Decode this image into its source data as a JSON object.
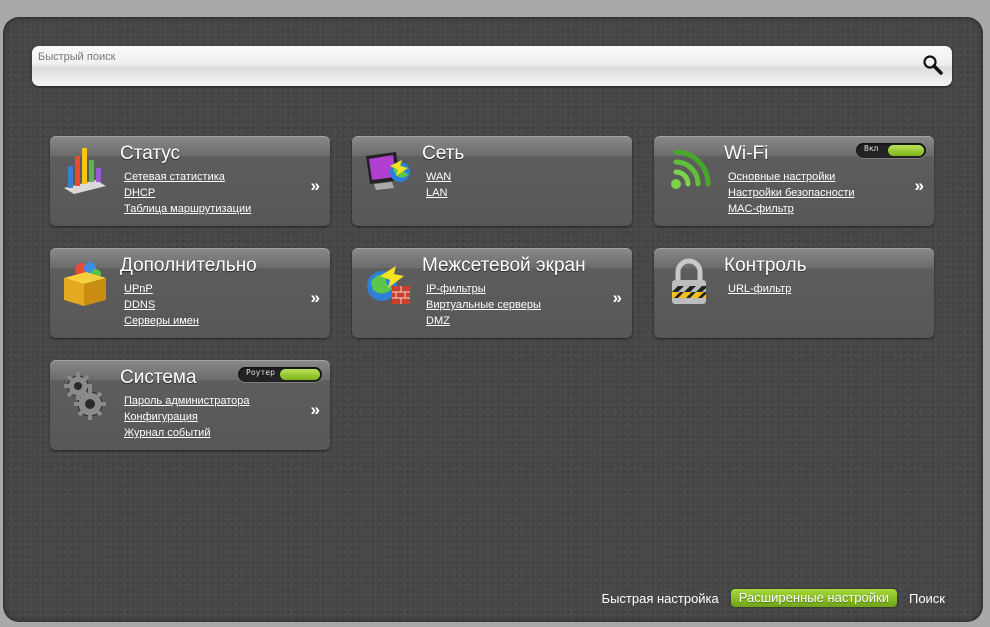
{
  "search": {
    "placeholder": "Быстрый поиск"
  },
  "cards": {
    "status": {
      "title": "Статус",
      "links": [
        "Сетевая статистика",
        "DHCP",
        "Таблица маршрутизации"
      ],
      "arrow": "»"
    },
    "network": {
      "title": "Сеть",
      "links": [
        "WAN",
        "LAN"
      ]
    },
    "wifi": {
      "title": "Wi-Fi",
      "links": [
        "Основные настройки",
        "Настройки безопасности",
        "MAC-фильтр"
      ],
      "arrow": "»",
      "toggle_label": "Вкл"
    },
    "advanced": {
      "title": "Дополнительно",
      "links": [
        "UPnP",
        "DDNS",
        "Серверы имен"
      ],
      "arrow": "»"
    },
    "firewall": {
      "title": "Межсетевой экран",
      "links": [
        "IP-фильтры",
        "Виртуальные серверы",
        "DMZ"
      ],
      "arrow": "»"
    },
    "control": {
      "title": "Контроль",
      "links": [
        "URL-фильтр"
      ]
    },
    "system": {
      "title": "Система",
      "links": [
        "Пароль администратора",
        "Конфигурация",
        "Журнал событий"
      ],
      "arrow": "»",
      "toggle_label": "Роутер"
    }
  },
  "footer": {
    "quick_setup": "Быстрая настройка",
    "advanced_settings": "Расширенные настройки",
    "search": "Поиск"
  },
  "colors": {
    "accent_green": "#8cc63f",
    "panel_bg": "#474747",
    "card_bg": "#5d5d5d"
  },
  "icons": {
    "search": "magnifier-icon",
    "status": "bar-chart-icon",
    "network": "monitor-globe-icon",
    "wifi": "wifi-signal-icon",
    "advanced": "box-icon",
    "firewall": "globe-firewall-icon",
    "control": "padlock-icon",
    "system": "gears-icon"
  }
}
